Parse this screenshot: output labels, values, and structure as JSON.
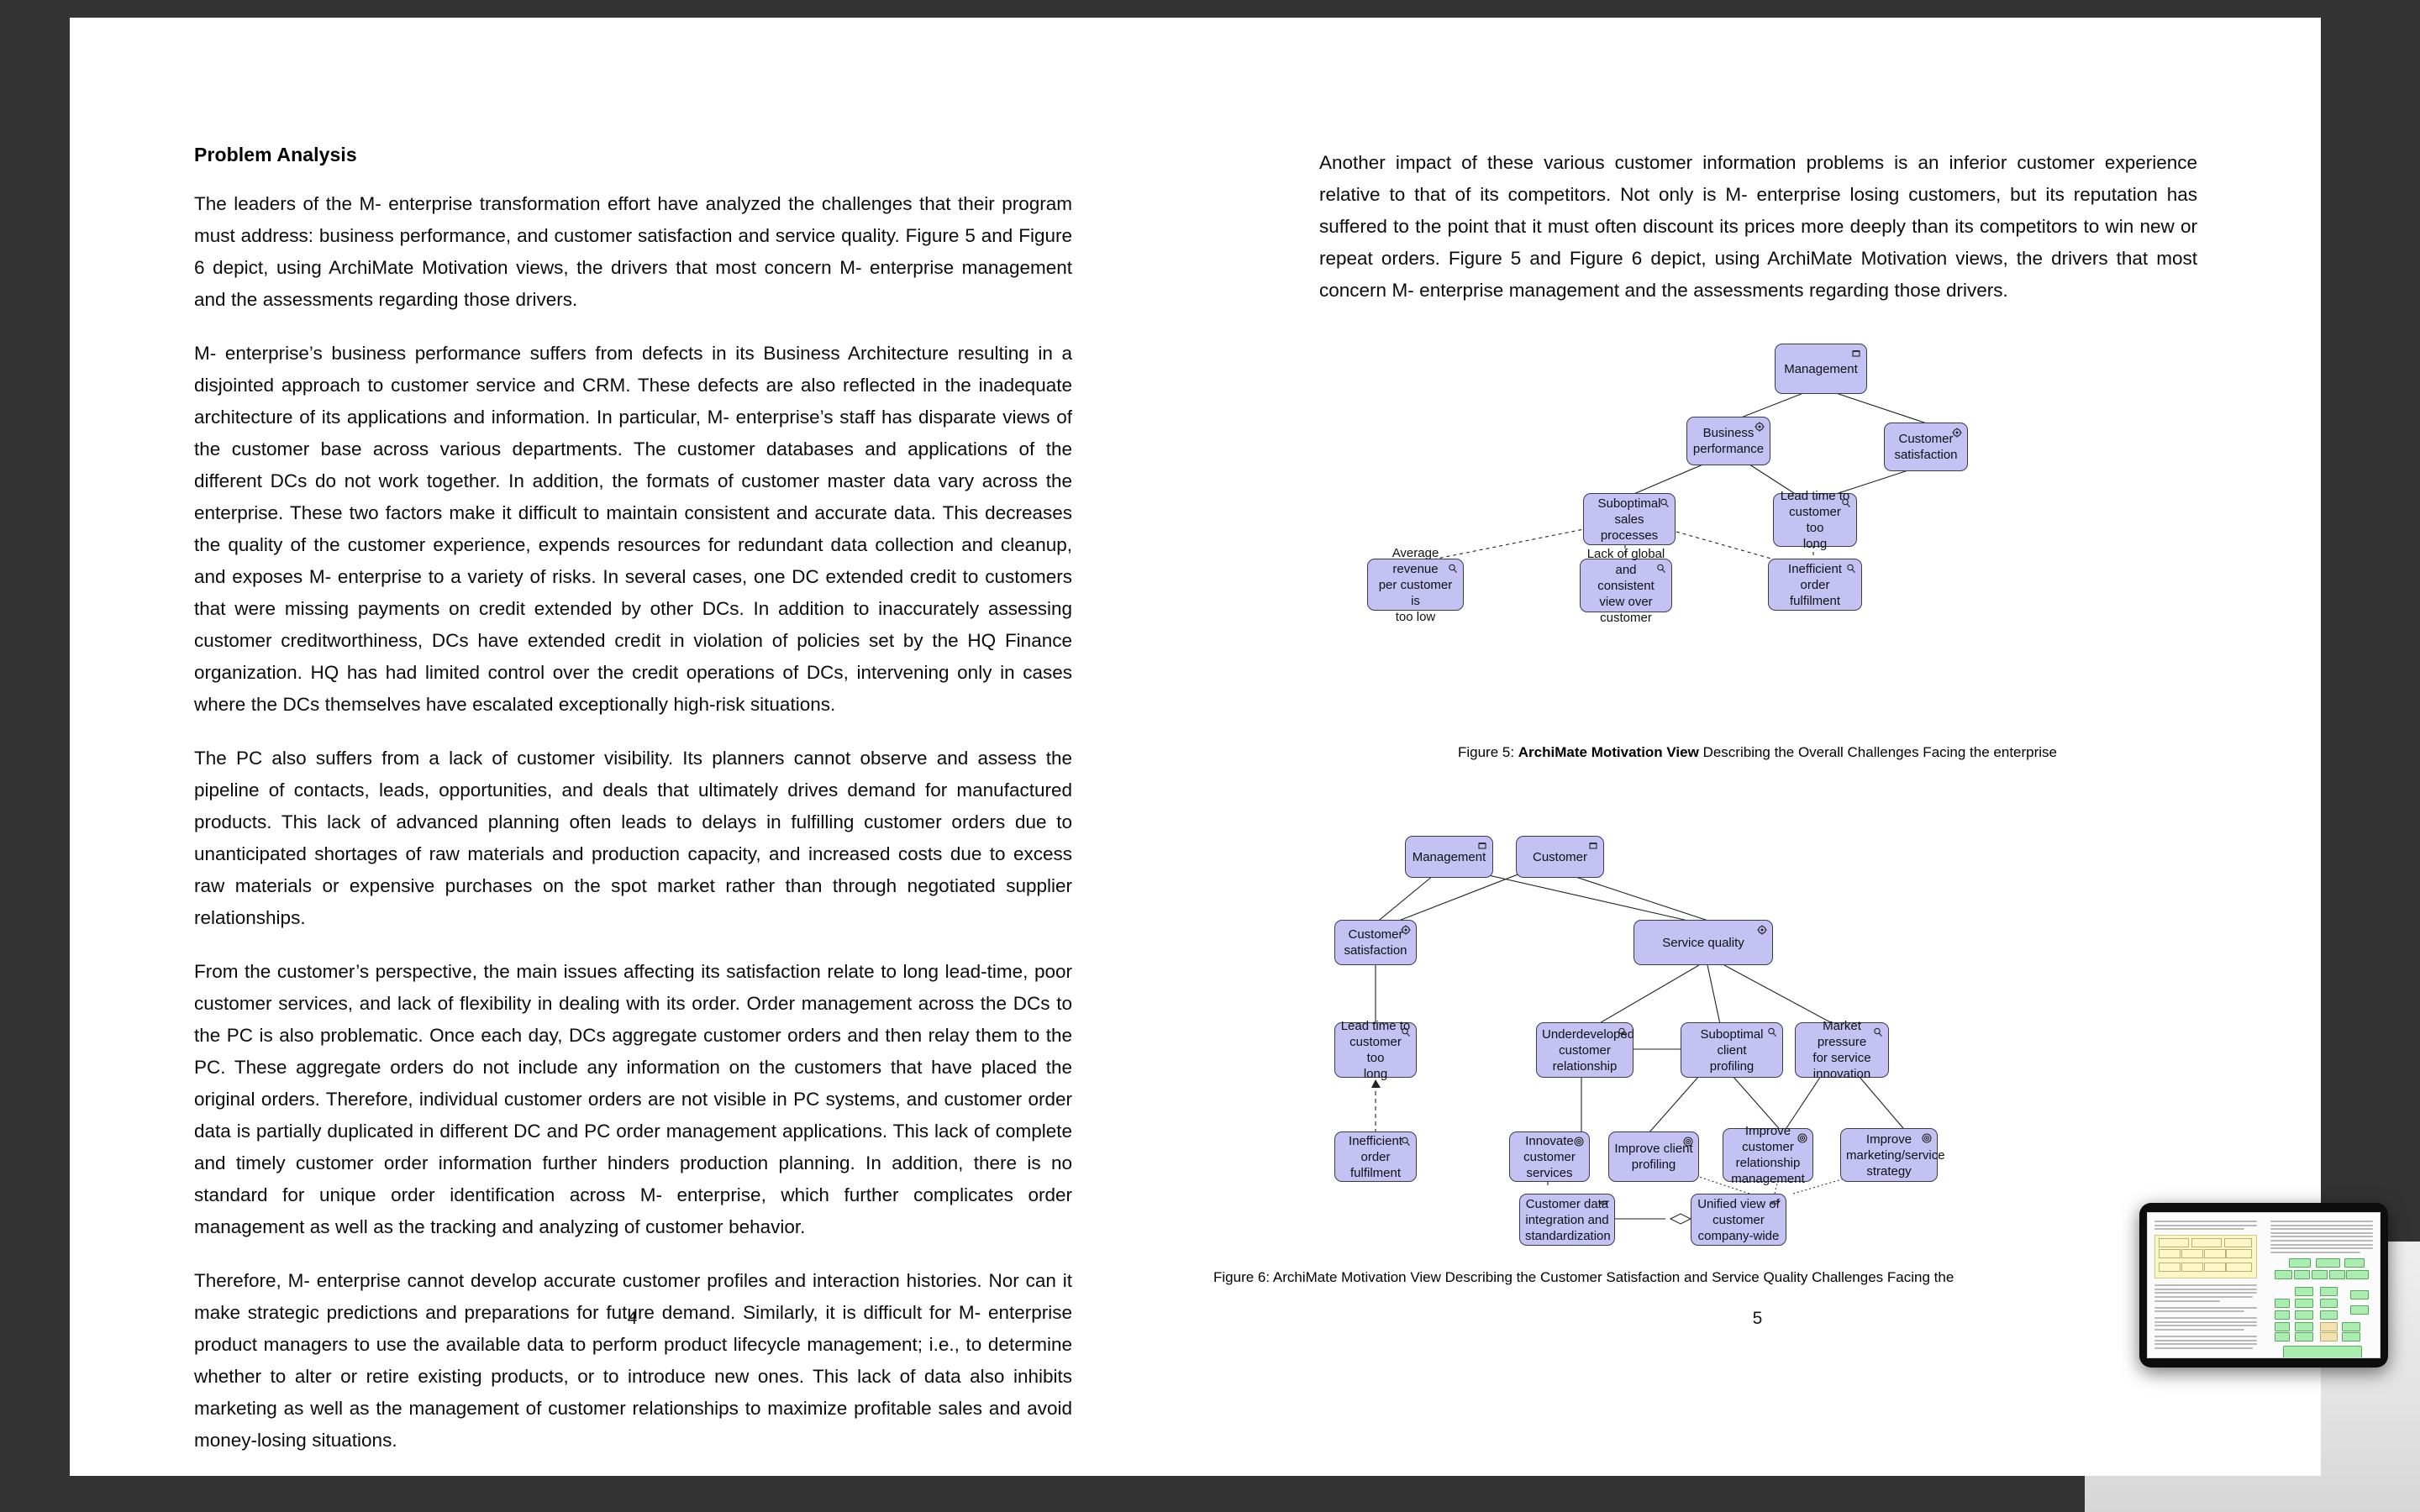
{
  "document": {
    "left_page": {
      "page_number": "4",
      "section_title": "Problem Analysis",
      "paragraphs": [
        "The leaders of the M- enterprise transformation effort have analyzed the challenges that their program must address: business performance, and customer satisfaction and service quality. Figure 5 and Figure 6 depict, using ArchiMate Motivation views, the drivers that most concern M- enterprise management and the assessments regarding those drivers.",
        "M- enterprise’s business performance suffers from defects in its Business Architecture resulting in a disjointed approach to customer service and CRM. These defects are also reflected in the inadequate architecture of its applications and information. In particular, M- enterprise’s staff has disparate views of the customer base across various departments. The customer databases and applications of the different DCs do not work together. In addition, the formats of customer master data vary across the enterprise. These two factors make it difficult to maintain consistent and accurate data. This decreases the quality of the customer experience, expends resources for redundant data collection and cleanup, and exposes M- enterprise to a variety of risks. In several cases, one DC extended credit to customers that were missing payments on credit extended by other DCs. In addition to inaccurately assessing customer creditworthiness, DCs have extended credit in violation of policies set by the HQ Finance organization. HQ has had limited control over the credit operations of DCs, intervening only in cases where the DCs themselves have escalated exceptionally high-risk situations.",
        "The PC also suffers from a lack of customer visibility. Its planners cannot observe and assess the pipeline of contacts, leads, opportunities, and deals that ultimately drives demand for manufactured products. This lack of advanced planning often leads to delays in fulfilling customer orders due to unanticipated shortages of raw materials and production capacity, and increased costs due to excess raw materials or expensive purchases on the spot market rather than through negotiated supplier relationships.",
        "From the customer’s perspective, the main issues affecting its satisfaction relate to long lead-time, poor customer services, and lack of flexibility in dealing with its order. Order management across the DCs to the PC is also problematic. Once each day, DCs aggregate customer orders and then relay them to the PC. These aggregate orders do not include any information on the customers that have placed the original orders. Therefore, individual customer orders are not visible in PC systems, and customer order data is partially duplicated in different DC and PC order management applications. This lack of complete and timely customer order information further hinders production planning. In addition, there is no standard for unique order identification across M- enterprise, which further complicates order management as well as the tracking and analyzing of customer behavior.",
        "Therefore, M- enterprise cannot develop accurate customer profiles and interaction histories. Nor can it make strategic predictions and preparations for future demand. Similarly, it is difficult for M- enterprise product managers to use the available data to perform product lifecycle management; i.e., to determine whether to alter or retire existing products, or to introduce new ones. This lack of data also inhibits marketing as well as the management of customer relationships to maximize profitable sales and avoid money-losing situations."
      ]
    },
    "right_page": {
      "page_number": "5",
      "paragraphs": [
        "Another impact of these various customer information problems is an inferior customer experience relative to that of its competitors. Not only is M- enterprise losing customers, but its reputation has suffered to the point that it must often discount its prices more deeply than its competitors to win new or repeat orders. Figure 5 and Figure 6 depict, using ArchiMate Motivation views, the drivers that most concern M- enterprise management and the assessments regarding those drivers."
      ]
    }
  },
  "figure5": {
    "caption_prefix": "Figure 5: ",
    "caption_strong": "ArchiMate Motivation View",
    "caption_suffix": " Describing the Overall Challenges Facing the enterprise",
    "node_fill": "#c3c2f2",
    "node_stroke": "#3a3a55",
    "nodes": [
      {
        "id": "management",
        "label": "Management",
        "type": "stakeholder"
      },
      {
        "id": "business-performance",
        "label": "Business\nperformance",
        "type": "driver"
      },
      {
        "id": "customer-satisfaction",
        "label": "Customer\nsatisfaction",
        "type": "driver"
      },
      {
        "id": "suboptimal-sales-processes",
        "label": "Suboptimal sales\nprocesses",
        "type": "assessment"
      },
      {
        "id": "lead-time-too-long",
        "label": "Lead time to\ncustomer too\nlong",
        "type": "assessment"
      },
      {
        "id": "average-revenue-too-low",
        "label": "Average revenue\nper customer is\ntoo low",
        "type": "assessment"
      },
      {
        "id": "lack-of-global-view",
        "label": "Lack of global\nand consistent\nview over\ncustomer",
        "type": "assessment"
      },
      {
        "id": "inefficient-order-fulfilment",
        "label": "Inefficient order\nfulfilment",
        "type": "assessment"
      }
    ],
    "edges": [
      {
        "from": "business-performance",
        "to": "management",
        "style": "solid"
      },
      {
        "from": "customer-satisfaction",
        "to": "management",
        "style": "solid"
      },
      {
        "from": "suboptimal-sales-processes",
        "to": "business-performance",
        "style": "solid"
      },
      {
        "from": "lead-time-too-long",
        "to": "business-performance",
        "style": "solid"
      },
      {
        "from": "lead-time-too-long",
        "to": "customer-satisfaction",
        "style": "solid"
      },
      {
        "from": "average-revenue-too-low",
        "to": "suboptimal-sales-processes",
        "style": "dashed"
      },
      {
        "from": "lack-of-global-view",
        "to": "suboptimal-sales-processes",
        "style": "dashed"
      },
      {
        "from": "inefficient-order-fulfilment",
        "to": "suboptimal-sales-processes",
        "style": "dashed"
      },
      {
        "from": "inefficient-order-fulfilment",
        "to": "lead-time-too-long",
        "style": "dashed"
      }
    ]
  },
  "figure6": {
    "caption": "Figure 6: ArchiMate Motivation View Describing the Customer Satisfaction and Service Quality Challenges Facing the",
    "nodes": [
      {
        "id": "management",
        "label": "Management",
        "type": "stakeholder"
      },
      {
        "id": "customer",
        "label": "Customer",
        "type": "stakeholder"
      },
      {
        "id": "customer-satisfaction",
        "label": "Customer\nsatisfaction",
        "type": "driver"
      },
      {
        "id": "service-quality",
        "label": "Service quality",
        "type": "driver"
      },
      {
        "id": "lead-time-too-long",
        "label": "Lead time to\ncustomer too\nlong",
        "type": "assessment"
      },
      {
        "id": "underdeveloped-customer-relationship",
        "label": "Underdeveloped\ncustomer\nrelationship",
        "type": "assessment"
      },
      {
        "id": "suboptimal-client-profiling",
        "label": "Suboptimal client\nprofiling",
        "type": "assessment"
      },
      {
        "id": "market-pressure-service-innovation",
        "label": "Market pressure\nfor service\ninnovation",
        "type": "assessment"
      },
      {
        "id": "inefficient-order-fulfilment",
        "label": "Inefficient order\nfulfilment",
        "type": "assessment"
      },
      {
        "id": "innovate-customer-services",
        "label": "Innovate\ncustomer\nservices",
        "type": "goal"
      },
      {
        "id": "improve-client-profiling",
        "label": "Improve client\nprofiling",
        "type": "goal"
      },
      {
        "id": "improve-customer-relationship-management",
        "label": "Improve\ncustomer\nrelationship\nmanagement",
        "type": "goal"
      },
      {
        "id": "improve-marketing-service-strategy",
        "label": "Improve\nmarketing/service\nstrategy",
        "type": "goal"
      },
      {
        "id": "customer-data-integration",
        "label": "Customer data\nintegration and\nstandardization",
        "type": "requirement"
      },
      {
        "id": "unified-view-of-customer",
        "label": "Unified view of\ncustomer\ncompany-wide",
        "type": "requirement"
      }
    ],
    "edges": [
      {
        "from": "customer-satisfaction",
        "to": "management",
        "style": "solid"
      },
      {
        "from": "customer-satisfaction",
        "to": "customer",
        "style": "solid"
      },
      {
        "from": "service-quality",
        "to": "management",
        "style": "solid"
      },
      {
        "from": "service-quality",
        "to": "customer",
        "style": "solid"
      },
      {
        "from": "lead-time-too-long",
        "to": "customer-satisfaction",
        "style": "solid"
      },
      {
        "from": "underdeveloped-customer-relationship",
        "to": "service-quality",
        "style": "solid"
      },
      {
        "from": "suboptimal-client-profiling",
        "to": "service-quality",
        "style": "solid"
      },
      {
        "from": "market-pressure-service-innovation",
        "to": "service-quality",
        "style": "solid"
      },
      {
        "from": "inefficient-order-fulfilment",
        "to": "lead-time-too-long",
        "style": "dashed"
      },
      {
        "from": "innovate-customer-services",
        "to": "underdeveloped-customer-relationship",
        "style": "solid"
      },
      {
        "from": "improve-client-profiling",
        "to": "suboptimal-client-profiling",
        "style": "solid"
      },
      {
        "from": "improve-customer-relationship-management",
        "to": "suboptimal-client-profiling",
        "style": "solid"
      },
      {
        "from": "improve-customer-relationship-management",
        "to": "market-pressure-service-innovation",
        "style": "solid"
      },
      {
        "from": "improve-marketing-service-strategy",
        "to": "market-pressure-service-innovation",
        "style": "solid"
      },
      {
        "from": "unified-view-of-customer",
        "to": "improve-client-profiling",
        "style": "dotted"
      },
      {
        "from": "unified-view-of-customer",
        "to": "improve-customer-relationship-management",
        "style": "dotted"
      },
      {
        "from": "unified-view-of-customer",
        "to": "improve-marketing-service-strategy",
        "style": "dotted"
      },
      {
        "from": "customer-data-integration",
        "to": "unified-view-of-customer",
        "style": "aggregation"
      }
    ]
  },
  "overlay": {
    "device": "tablet",
    "content": "document-page-thumbnail"
  }
}
